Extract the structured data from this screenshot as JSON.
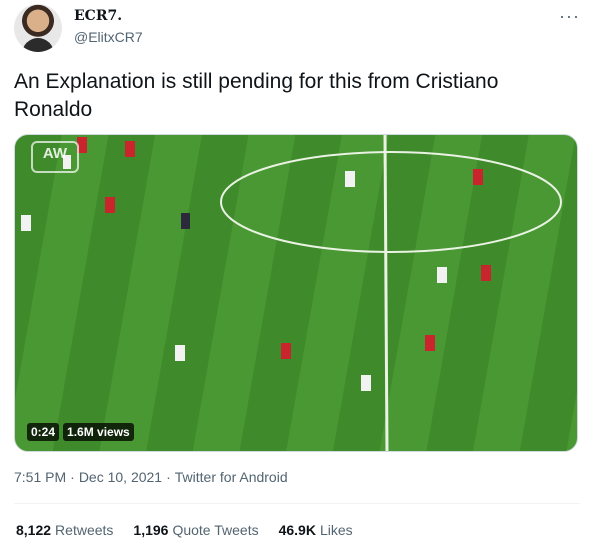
{
  "author": {
    "name": "ECR7.",
    "handle": "@ElitxCR7"
  },
  "tweet": {
    "text": "An Explanation is still pending for this from Cristiano Ronaldo"
  },
  "video": {
    "watermark": "AW",
    "duration": "0:24",
    "views": "1.6M views"
  },
  "meta": {
    "time": "7:51 PM",
    "date": "Dec 10, 2021",
    "source": "Twitter for Android",
    "separator": "·"
  },
  "stats": {
    "retweets": {
      "count": "8,122",
      "label": "Retweets"
    },
    "quotes": {
      "count": "1,196",
      "label": "Quote Tweets"
    },
    "likes": {
      "count": "46.9K",
      "label": "Likes"
    }
  },
  "icons": {
    "more": "more-options-icon"
  }
}
